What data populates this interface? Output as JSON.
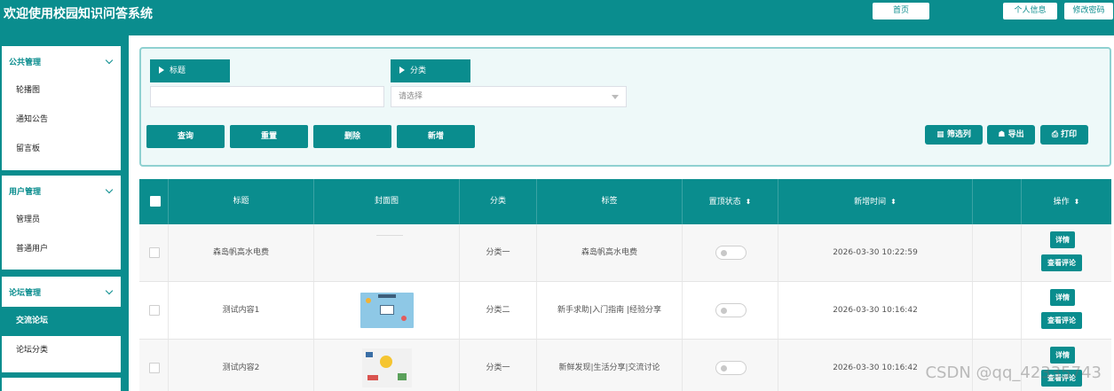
{
  "header": {
    "title": "欢迎使用校园知识问答系统",
    "home": "首页",
    "profile": "个人信息",
    "change_password": "修改密码"
  },
  "sidebar": {
    "groups": [
      {
        "title": "公共管理",
        "items": [
          "轮播图",
          "通知公告",
          "留言板"
        ]
      },
      {
        "title": "用户管理",
        "items": [
          "管理员",
          "普通用户"
        ]
      },
      {
        "title": "论坛管理",
        "items": [
          "交流论坛",
          "论坛分类"
        ]
      }
    ],
    "active_item": "交流论坛"
  },
  "filters": {
    "title_label": "标题",
    "title_value": "",
    "category_label": "分类",
    "category_placeholder": "请选择"
  },
  "actions": {
    "query": "查询",
    "reset": "重置",
    "delete": "删除",
    "add": "新增",
    "filter_columns": "筛选列",
    "export": "导出",
    "print": "打印"
  },
  "table": {
    "columns": [
      "标题",
      "封面图",
      "分类",
      "标签",
      "置顶状态",
      "新增时间",
      "",
      "操作"
    ],
    "rows": [
      {
        "title": "森岛帆高水电费",
        "category": "分类一",
        "tags": "森岛帆高水电费",
        "pinned": false,
        "created": "2026-03-30 10:22:59"
      },
      {
        "title": "测试内容1",
        "category": "分类二",
        "tags": "新手求助|入门指南 |经验分享",
        "pinned": false,
        "created": "2026-03-30 10:16:42"
      },
      {
        "title": "测试内容2",
        "category": "分类一",
        "tags": "新鲜发现|生活分享|交流讨论",
        "pinned": false,
        "created": "2026-03-30 10:16:42"
      }
    ],
    "row_actions": {
      "detail": "详情",
      "comments": "查看评论"
    }
  },
  "watermark": "CSDN @qq_42335743",
  "colors": {
    "primary": "#0a8d8e",
    "panel_bg": "#eef9f9"
  }
}
